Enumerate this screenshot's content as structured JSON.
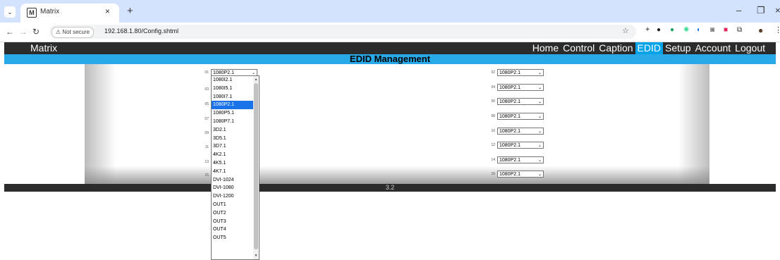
{
  "browser": {
    "tab_title": "Matrix",
    "tab_icon": "M",
    "tab_close": "×",
    "new_tab": "+",
    "security_label": "Not secure",
    "url": "192.168.1.80/Config.shtml",
    "icons": [
      "chevron-down-icon",
      "tab-favicon-icon",
      "close-icon",
      "plus-icon",
      "back-icon",
      "forward-icon",
      "reload-icon",
      "warning-icon",
      "star-icon",
      "extension-icons",
      "profile-icon",
      "more-icon",
      "minimize-icon",
      "restore-icon"
    ]
  },
  "app": {
    "brand": "Matrix",
    "nav": [
      {
        "label": "Home",
        "active": false
      },
      {
        "label": "Control",
        "active": false
      },
      {
        "label": "Caption",
        "active": false
      },
      {
        "label": "EDID",
        "active": true
      },
      {
        "label": "Setup",
        "active": false
      },
      {
        "label": "Account",
        "active": false
      },
      {
        "label": "Logout",
        "active": false
      }
    ],
    "page_title": "EDID Management",
    "footer_version": "3.2"
  },
  "edid": {
    "ports": [
      {
        "num": "01",
        "value": "1080P2.1"
      },
      {
        "num": "02",
        "value": "1080P2.1"
      },
      {
        "num": "03",
        "value": ""
      },
      {
        "num": "04",
        "value": "1080P2.1"
      },
      {
        "num": "05",
        "value": ""
      },
      {
        "num": "06",
        "value": "1080P2.1"
      },
      {
        "num": "07",
        "value": ""
      },
      {
        "num": "08",
        "value": "1080P2.1"
      },
      {
        "num": "09",
        "value": ""
      },
      {
        "num": "10",
        "value": "1080P2.1"
      },
      {
        "num": "11",
        "value": ""
      },
      {
        "num": "12",
        "value": "1080P2.1"
      },
      {
        "num": "13",
        "value": ""
      },
      {
        "num": "14",
        "value": "1080P2.1"
      },
      {
        "num": "15",
        "value": ""
      },
      {
        "num": "16",
        "value": "1080P2.1"
      }
    ],
    "open_dropdown": {
      "for_port": "01",
      "selected": "1080P2.1",
      "options": [
        "1080I2.1",
        "1080I5.1",
        "1080I7.1",
        "1080P2.1",
        "1080P5.1",
        "1080P7.1",
        "3D2.1",
        "3D5.1",
        "3D7.1",
        "4K2.1",
        "4K5.1",
        "4K7.1",
        "DVI-1024",
        "DVI-1080",
        "DVI-1200",
        "OUT1",
        "OUT2",
        "OUT3",
        "OUT4",
        "OUT5"
      ]
    }
  },
  "colors": {
    "header_bg": "#2b2b2b",
    "accent": "#29a9e7",
    "active_nav": "#00a2e8",
    "selected_option": "#1a73e8"
  }
}
